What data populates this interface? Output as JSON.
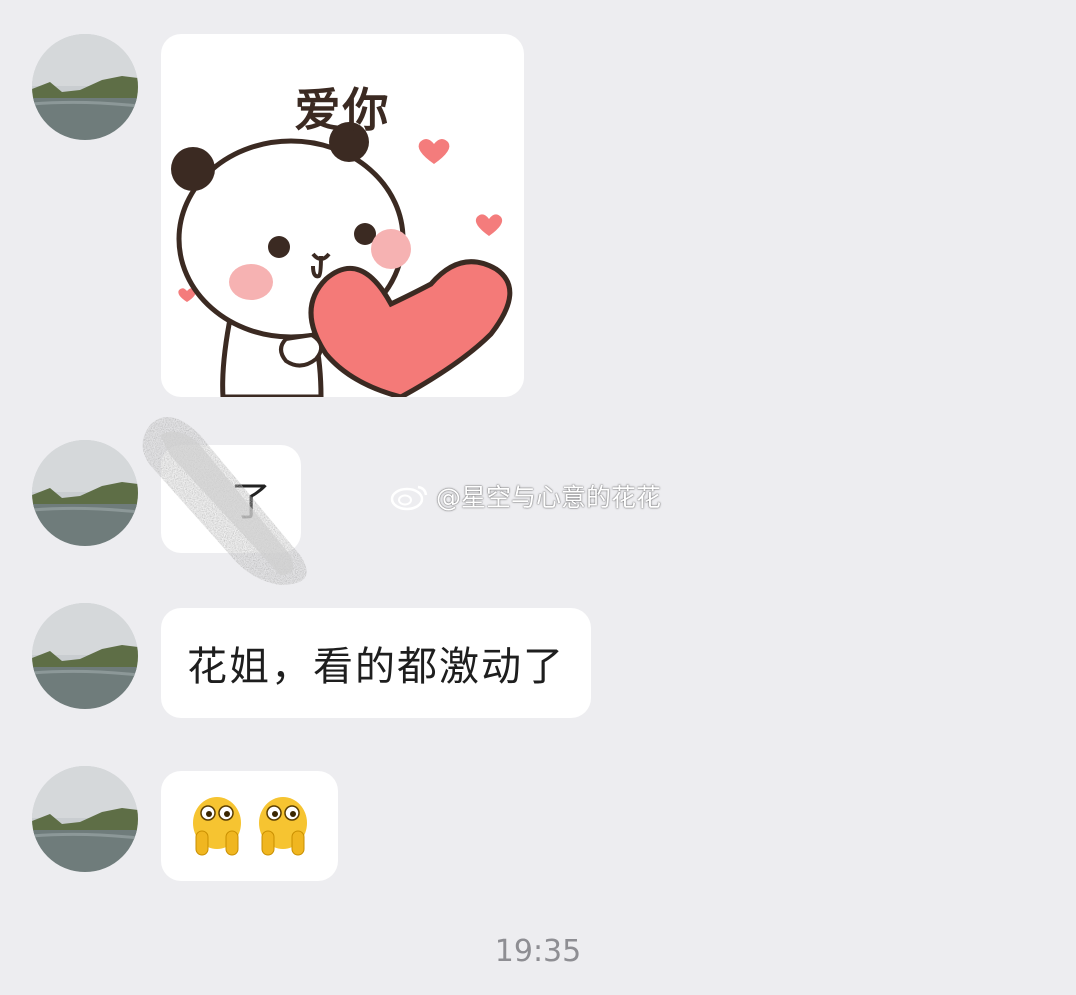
{
  "messages": [
    {
      "type": "sticker",
      "sticker_text": "爱你",
      "icon": "panda-heart-sticker"
    },
    {
      "type": "text",
      "text": "了",
      "redacted": true
    },
    {
      "type": "text",
      "text": "花姐，看的都激动了"
    },
    {
      "type": "emoji",
      "icon": "peeking-emoji",
      "count": 2
    }
  ],
  "timestamp": "19:35",
  "watermark": {
    "text": "@星空与心意的花花",
    "icon": "weibo-icon"
  },
  "colors": {
    "background": "#EDEDF0",
    "bubble": "#FFFFFF",
    "timestamp": "#8E8E93"
  }
}
